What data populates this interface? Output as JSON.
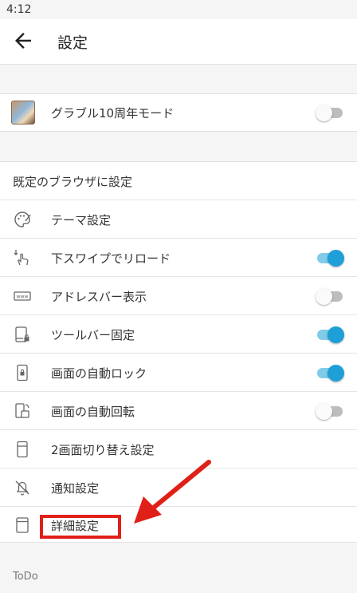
{
  "status_bar": {
    "time": "4:12"
  },
  "app_bar": {
    "title": "設定",
    "back_icon": "arrow-back-icon"
  },
  "top_card": {
    "label": "グラブル10周年モード",
    "toggle_on": false
  },
  "settings": [
    {
      "id": "default-browser",
      "label": "既定のブラウザに設定",
      "icon": "",
      "toggle": null
    },
    {
      "id": "theme",
      "label": "テーマ設定",
      "icon": "palette-icon",
      "toggle": null
    },
    {
      "id": "swipe-reload",
      "label": "下スワイプでリロード",
      "icon": "swipe-down-icon",
      "toggle": true
    },
    {
      "id": "address-bar",
      "label": "アドレスバー表示",
      "icon": "www-icon",
      "toggle": false
    },
    {
      "id": "toolbar-lock",
      "label": "ツールバー固定",
      "icon": "toolbar-lock-icon",
      "toggle": true
    },
    {
      "id": "screen-autolock",
      "label": "画面の自動ロック",
      "icon": "screen-lock-icon",
      "toggle": true
    },
    {
      "id": "screen-rotate",
      "label": "画面の自動回転",
      "icon": "screen-rotate-icon",
      "toggle": false
    },
    {
      "id": "dual-screen",
      "label": "2画面切り替え設定",
      "icon": "split-screen-icon",
      "toggle": null
    },
    {
      "id": "notification",
      "label": "通知設定",
      "icon": "bell-off-icon",
      "toggle": null
    },
    {
      "id": "advanced",
      "label": "詳細設定",
      "icon": "advanced-settings-icon",
      "toggle": null
    }
  ],
  "footer_section": {
    "label": "ToDo"
  },
  "colors": {
    "accent": "#1e9fd8",
    "annotation_red": "#e02018"
  }
}
